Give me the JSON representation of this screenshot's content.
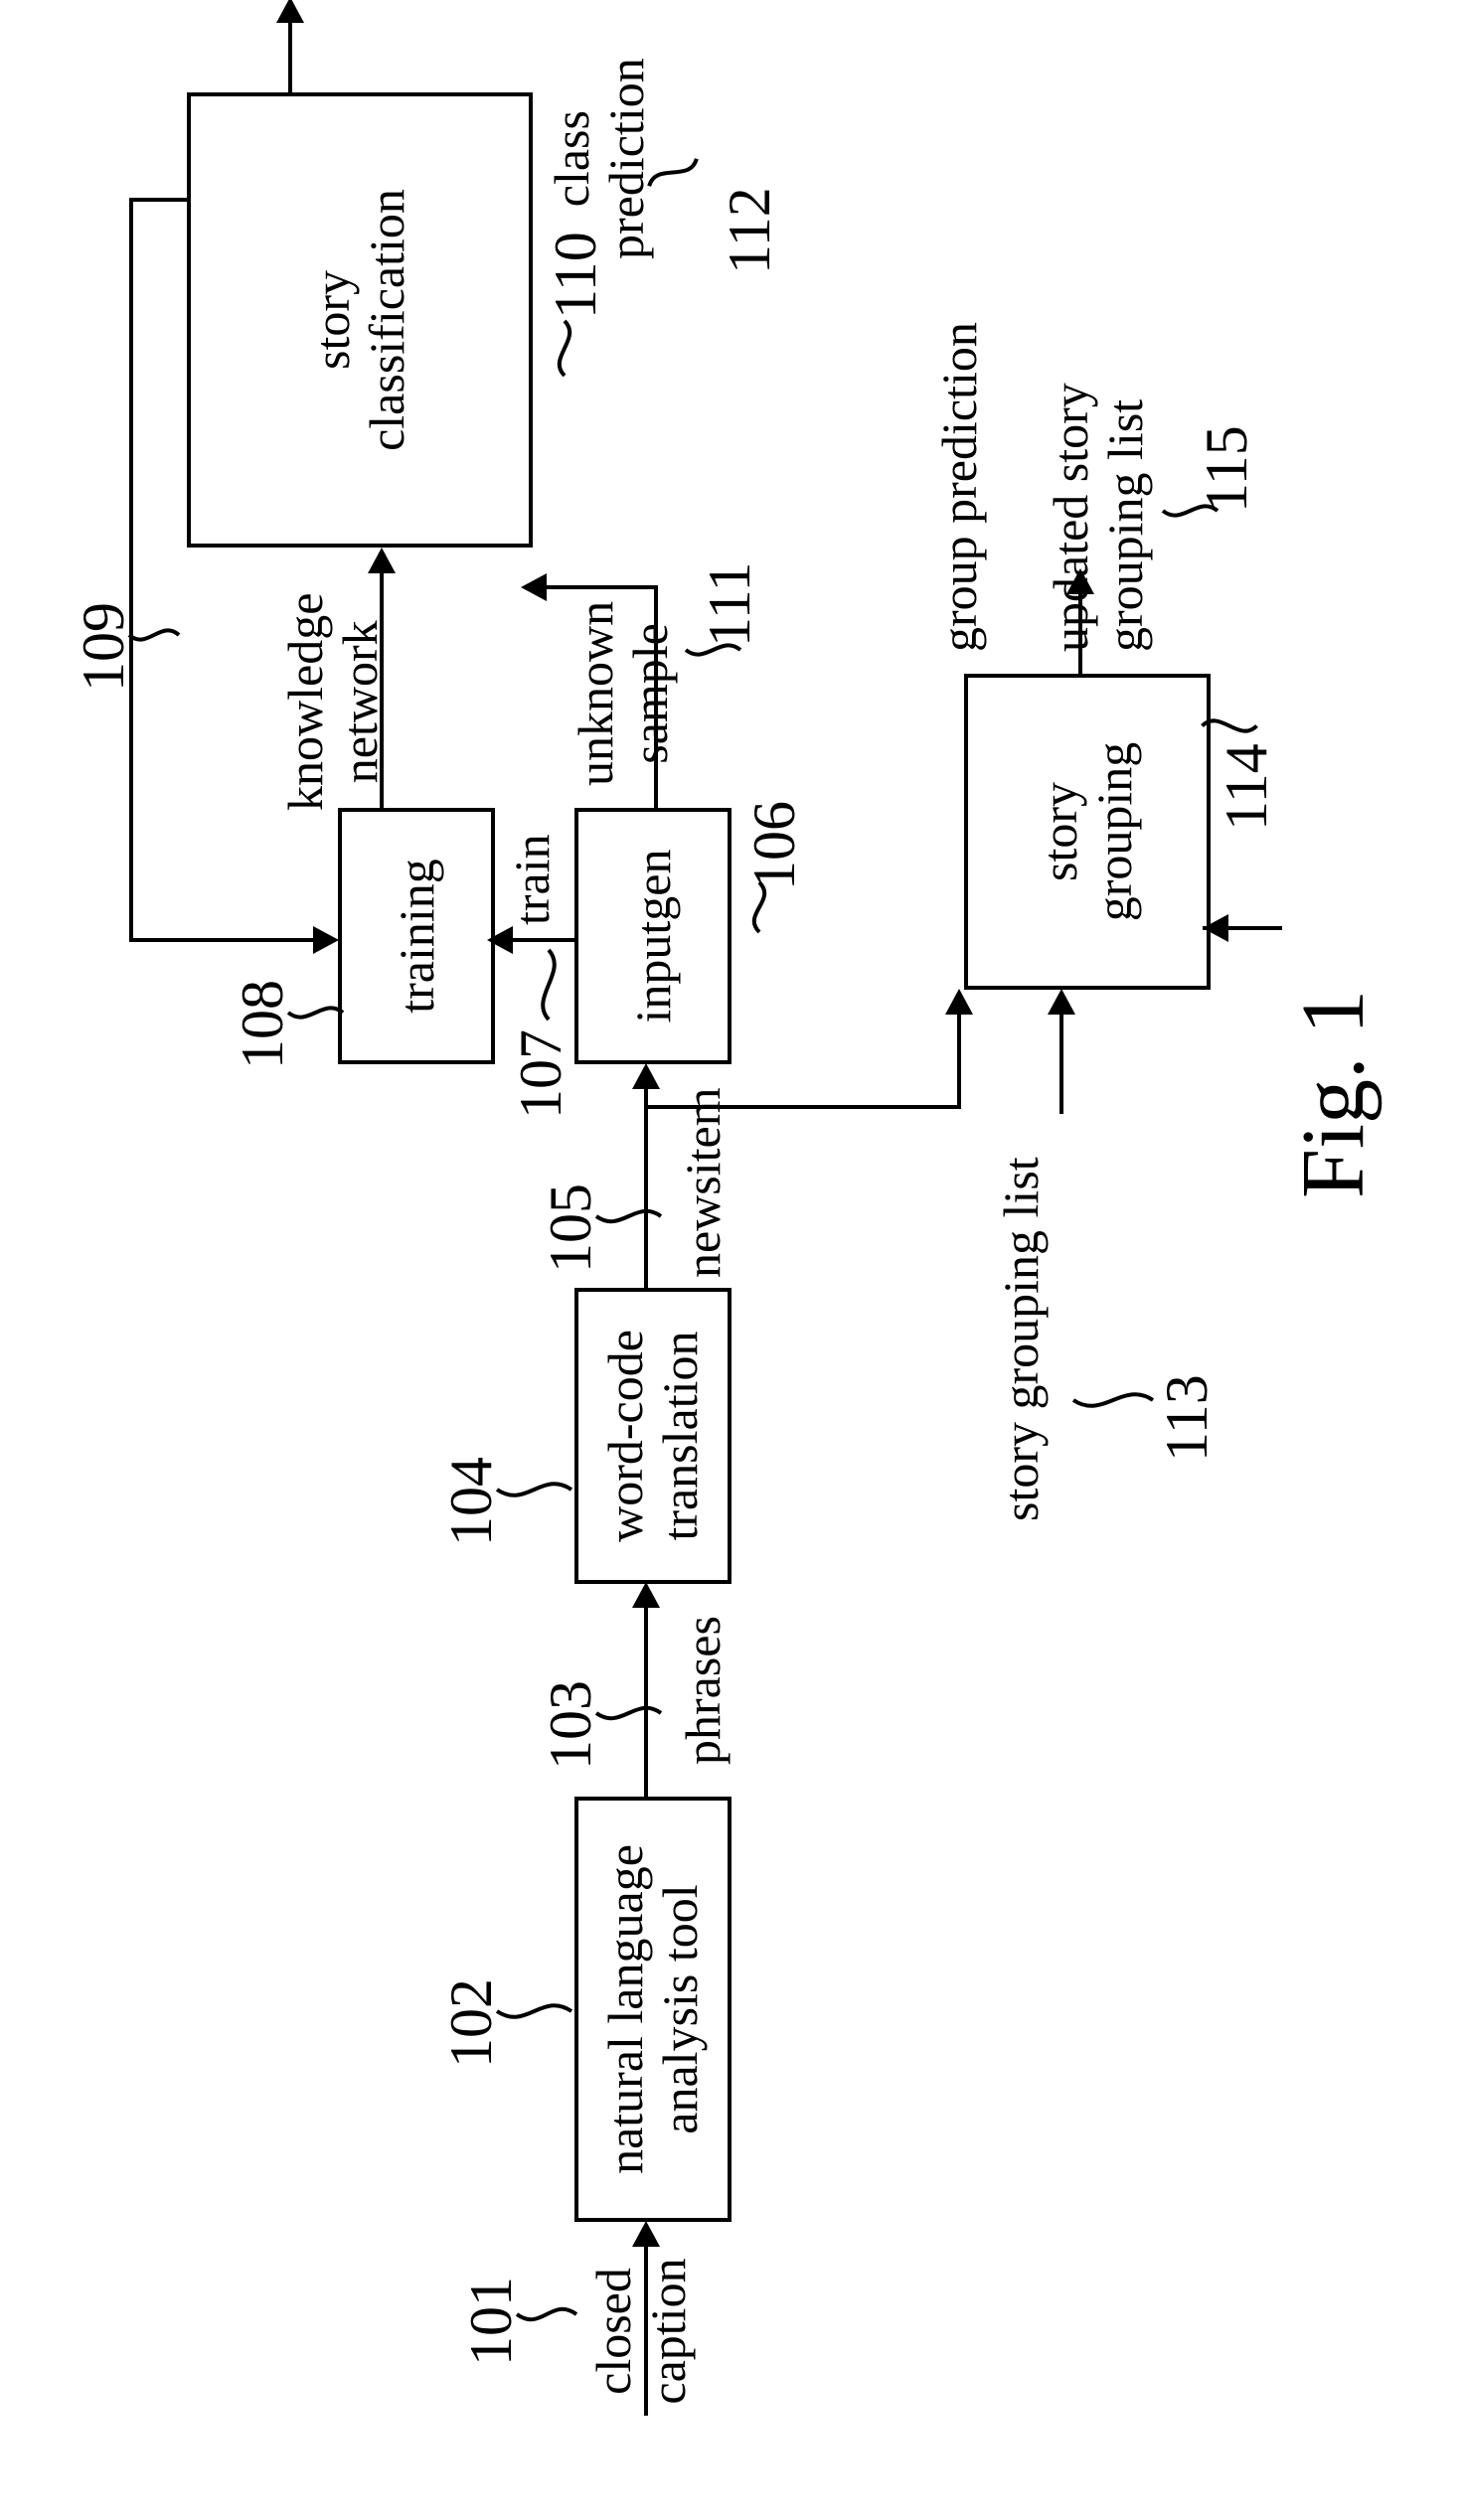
{
  "figure_label": "Fig. 1",
  "inputs": {
    "closed_caption": "closed\ncaption",
    "story_grouping_list_in": "story grouping list"
  },
  "blocks": {
    "nlp_tool": "natural language\nanalysis tool",
    "word_code_translation": "word-code\ntranslation",
    "inputgen": "inputgen",
    "training": "training",
    "story_classification": "story\nclassification",
    "story_grouping": "story\ngrouping"
  },
  "edges": {
    "phrases": "phrases",
    "newsitem": "newsitem",
    "train": "train",
    "knowledge_network": "knowledge\nnetwork",
    "unknown_sample": "unknown\nsample"
  },
  "outputs": {
    "class_prediction": "class\nprediction",
    "group_prediction": "group prediction",
    "updated_list": "updated story\ngrouping list"
  },
  "refs": {
    "r101": "101",
    "r102": "102",
    "r103": "103",
    "r104": "104",
    "r105": "105",
    "r106": "106",
    "r107": "107",
    "r108": "108",
    "r109": "109",
    "r110": "110",
    "r111": "111",
    "r112": "112",
    "r113": "113",
    "r114": "114",
    "r115": "115"
  }
}
